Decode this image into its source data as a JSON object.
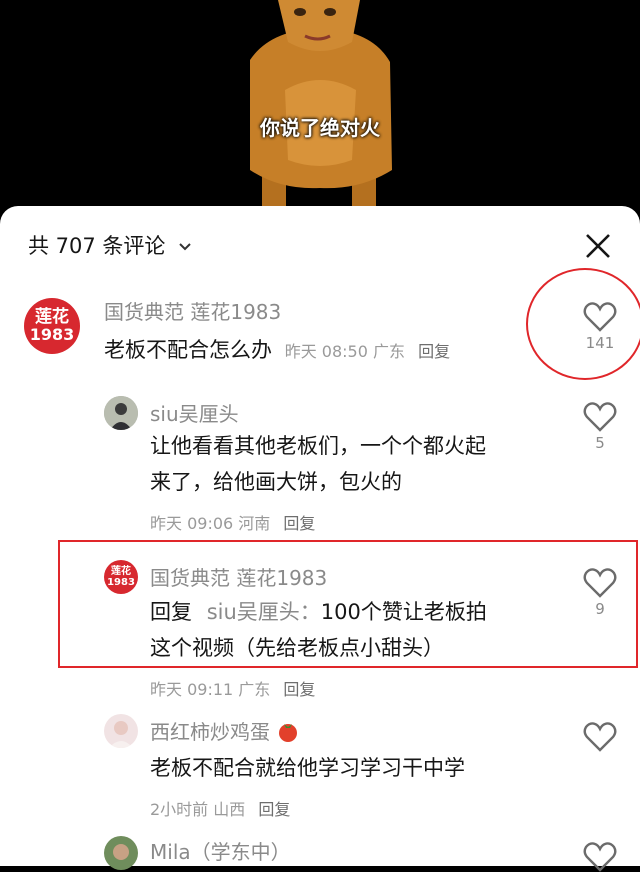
{
  "video": {
    "caption": "你说了绝对火"
  },
  "sheet": {
    "comment_count_label": "共 707 条评论"
  },
  "comments": [
    {
      "user": "国货典范 莲花1983",
      "avatar_logo": {
        "line1": "莲花",
        "line2": "1983"
      },
      "text": "老板不配合怎么办",
      "time": "昨天 08:50",
      "location": "广东",
      "reply_label": "回复",
      "likes": "141"
    },
    {
      "user": "siu吴厘头",
      "text_line1": "让他看看其他老板们，一个个都火起",
      "text_line2": "来了，给他画大饼，包火的",
      "time": "昨天 09:06",
      "location": "河南",
      "reply_label": "回复",
      "likes": "5"
    },
    {
      "user": "国货典范 莲花1983",
      "avatar_logo": {
        "line1": "莲花",
        "line2": "1983"
      },
      "reply_prefix": "回复",
      "reply_to": "siu吴厘头：",
      "text_line1": "100个赞让老板拍",
      "text_line2": "这个视频（先给老板点小甜头）",
      "time": "昨天 09:11",
      "location": "广东",
      "reply_label": "回复",
      "likes": "9"
    },
    {
      "user": "西红柿炒鸡蛋",
      "text": "老板不配合就给他学习学习干中学",
      "time": "2小时前",
      "location": "山西",
      "reply_label": "回复",
      "likes": ""
    },
    {
      "user": "Mila（学东中）"
    }
  ],
  "colors": {
    "highlight": "#e0262a",
    "brand_red": "#d7282f"
  },
  "icons": [
    "chevron-down-icon",
    "close-icon",
    "heart-icon",
    "tomato-emoji-icon"
  ]
}
